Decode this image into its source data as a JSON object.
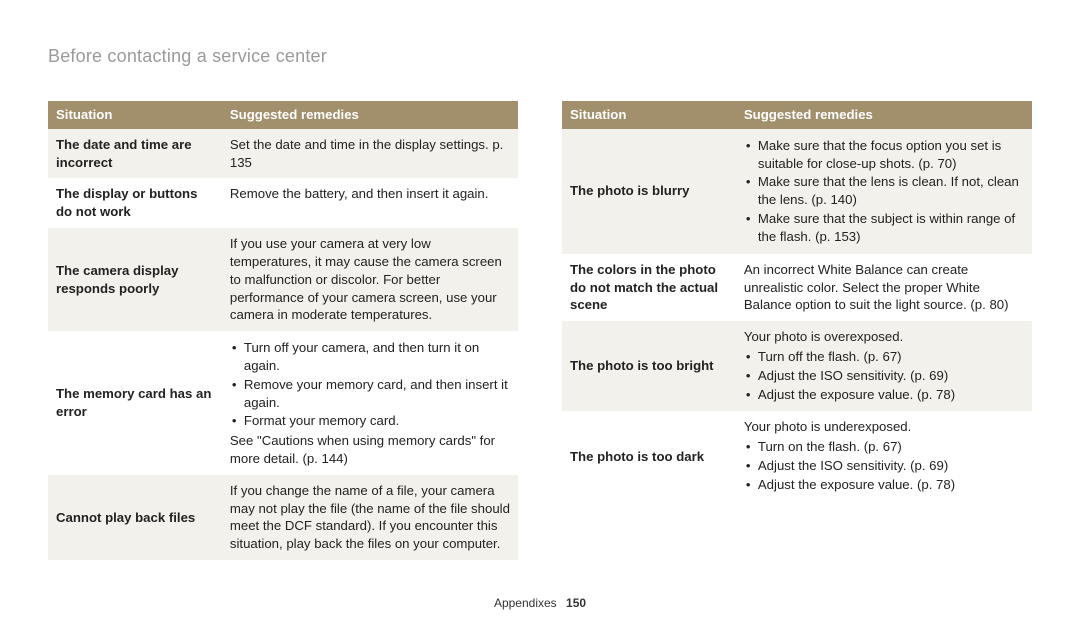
{
  "page_title": "Before contacting a service center",
  "footer_section": "Appendixes",
  "page_number": "150",
  "headers": {
    "situation": "Situation",
    "remedies": "Suggested remedies"
  },
  "left_table": [
    {
      "situation": "The date and time are incorrect",
      "remedy_text": "Set the date and time in the display settings. p. 135"
    },
    {
      "situation": "The display or buttons do not work",
      "remedy_text": "Remove the battery, and then insert it again."
    },
    {
      "situation": "The camera display responds poorly",
      "remedy_text": "If you use your camera at very low temperatures, it may cause the camera screen to malfunction or discolor. For better performance of your camera screen, use your camera in moderate temperatures."
    },
    {
      "situation": "The memory card has an error",
      "remedy_bullets": [
        "Turn off your camera, and then turn it on again.",
        "Remove your memory card, and then insert it again.",
        "Format your memory card."
      ],
      "remedy_tail": "See \"Cautions when using memory cards\" for more detail. (p. 144)"
    },
    {
      "situation": "Cannot play back files",
      "remedy_text": "If you change the name of a file, your camera may not play the file (the name of the file should meet the DCF standard). If you encounter this situation, play back the files on your computer."
    }
  ],
  "right_table": [
    {
      "situation": "The photo is blurry",
      "remedy_bullets": [
        "Make sure that the focus option you set is suitable for close-up shots. (p. 70)",
        "Make sure that the lens is clean. If not, clean the lens. (p. 140)",
        "Make sure that the subject is within range of the flash. (p. 153)"
      ]
    },
    {
      "situation": "The colors in the photo do not match the actual scene",
      "remedy_text": "An incorrect White Balance can create unrealistic color. Select the proper White Balance option to suit the light source. (p. 80)"
    },
    {
      "situation": "The photo is too bright",
      "remedy_lead": "Your photo is overexposed.",
      "remedy_bullets": [
        "Turn off the flash. (p. 67)",
        "Adjust the ISO sensitivity. (p. 69)",
        "Adjust the exposure value. (p. 78)"
      ]
    },
    {
      "situation": "The photo is too dark",
      "remedy_lead": "Your photo is underexposed.",
      "remedy_bullets": [
        "Turn on the flash. (p. 67)",
        "Adjust the ISO sensitivity. (p. 69)",
        "Adjust the exposure value. (p. 78)"
      ]
    }
  ]
}
